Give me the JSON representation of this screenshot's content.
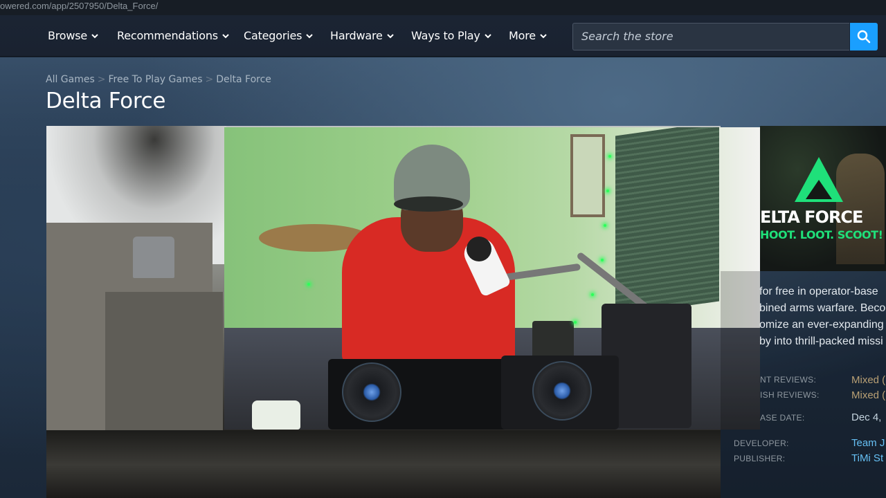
{
  "url_fragment": "owered.com/app/2507950/Delta_Force/",
  "nav": {
    "items": [
      "Browse",
      "Recommendations",
      "Categories",
      "Hardware",
      "Ways to Play",
      "More"
    ],
    "search_placeholder": "Search the store"
  },
  "breadcrumb": [
    "All Games",
    "Free To Play Games",
    "Delta Force"
  ],
  "page_title": "Delta Force",
  "capsule": {
    "title": "ELTA FORCE",
    "tagline": "HOOT. LOOT. SCOOT!"
  },
  "description_lines": [
    "for free in operator-base",
    "bined arms warfare. Beco",
    "omize an ever-expanding",
    "by into thrill-packed missi"
  ],
  "meta": {
    "recent_reviews_label": "NT REVIEWS:",
    "recent_reviews_value": "Mixed (",
    "english_reviews_label": "ISH REVIEWS:",
    "english_reviews_value": "Mixed (",
    "release_label": "ASE DATE:",
    "release_value": "Dec 4,",
    "developer_label": "DEVELOPER:",
    "developer_value": "Team J",
    "publisher_label": "PUBLISHER:",
    "publisher_value": "TiMi St"
  },
  "colors": {
    "accent": "#1a9fff",
    "mixed": "#b9a074",
    "link": "#66c0f4"
  }
}
